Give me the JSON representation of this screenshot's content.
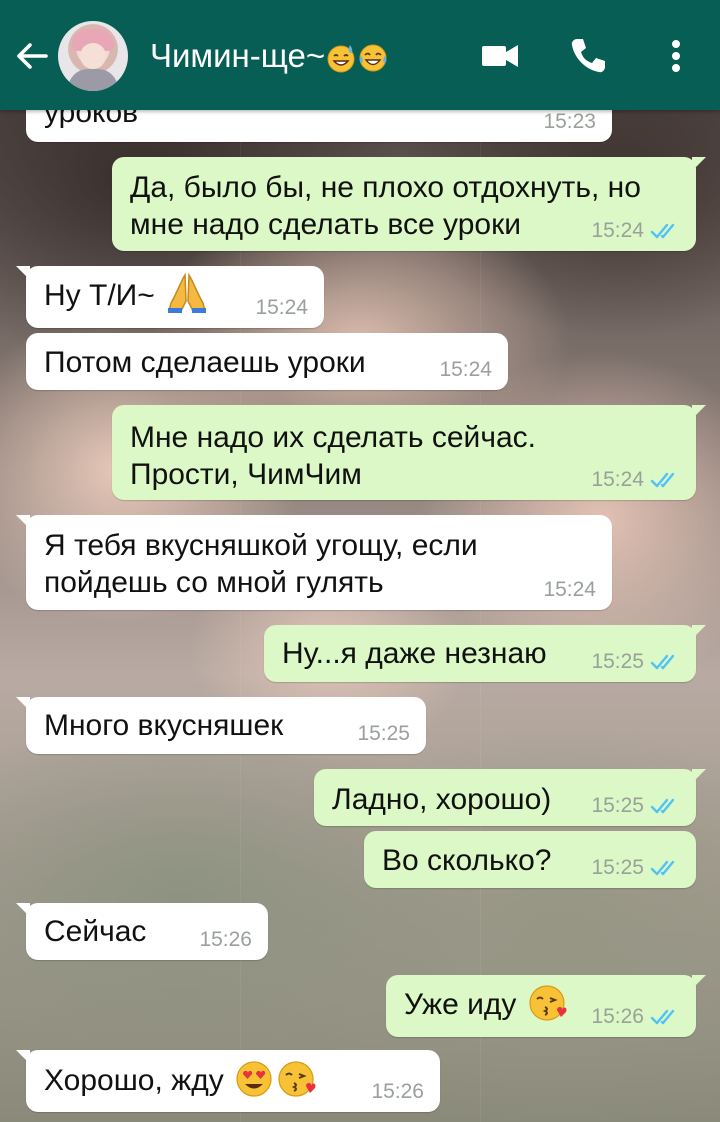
{
  "header": {
    "contact_name": "Чимин-ще~",
    "title_emojis": [
      "sweat-smile-emoji-icon",
      "tears-of-joy-emoji-icon"
    ],
    "icons": [
      "back-arrow-icon",
      "video-call-icon",
      "phone-call-icon",
      "more-options-icon"
    ],
    "color": "#075e54"
  },
  "colors": {
    "incoming": "#ffffff",
    "outgoing": "#dcf8c6",
    "tick": "#4fc3f7"
  },
  "messages": [
    {
      "dir": "in",
      "text": "уроков",
      "time": "15:23"
    },
    {
      "dir": "out",
      "text": "Да, было бы, не плохо отдохнуть, но мне надо сделать все уроки",
      "time": "15:24",
      "read": true
    },
    {
      "dir": "in",
      "text": "Ну Т/И~",
      "emojis": [
        "folded-hands-emoji-icon"
      ],
      "time": "15:24"
    },
    {
      "dir": "in",
      "text": "Потом сделаешь уроки",
      "time": "15:24"
    },
    {
      "dir": "out",
      "text": "Мне надо их сделать сейчас. Прости, ЧимЧим",
      "time": "15:24",
      "read": true
    },
    {
      "dir": "in",
      "text": "Я тебя вкусняшкой угощу, если пойдешь со мной гулять",
      "time": "15:24"
    },
    {
      "dir": "out",
      "text": "Ну...я даже незнаю",
      "time": "15:25",
      "read": true
    },
    {
      "dir": "in",
      "text": "Много вкусняшек",
      "time": "15:25"
    },
    {
      "dir": "out",
      "text": "Ладно, хорошо)",
      "time": "15:25",
      "read": true
    },
    {
      "dir": "out",
      "text": "Во сколько?",
      "time": "15:25",
      "read": true
    },
    {
      "dir": "in",
      "text": "Сейчас",
      "time": "15:26"
    },
    {
      "dir": "out",
      "text": "Уже иду",
      "emojis": [
        "kissing-heart-emoji-icon"
      ],
      "time": "15:26",
      "read": true
    },
    {
      "dir": "in",
      "text": "Хорошо, жду",
      "emojis": [
        "heart-eyes-emoji-icon",
        "kissing-heart-emoji-icon"
      ],
      "time": "15:26"
    }
  ]
}
